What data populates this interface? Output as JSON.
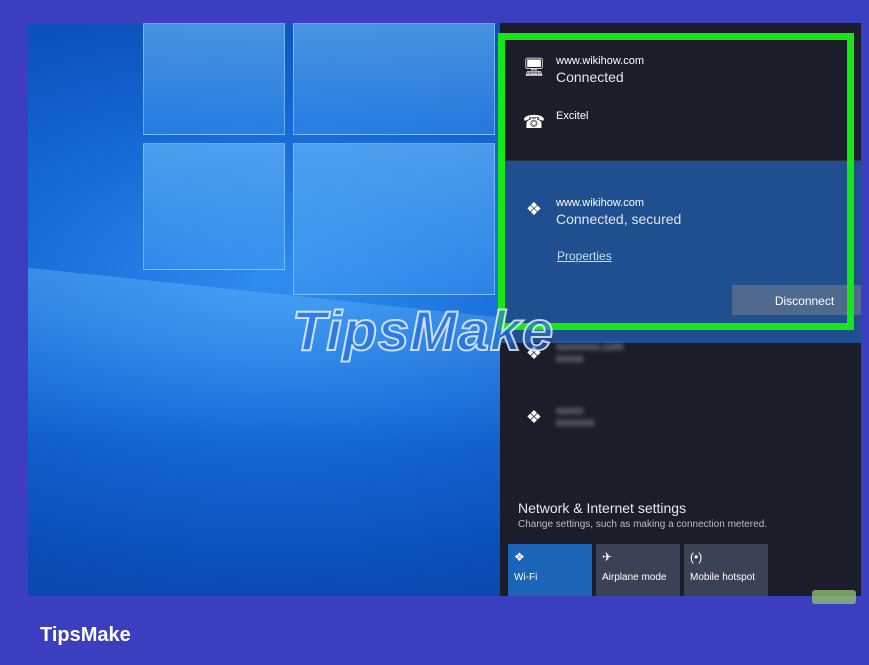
{
  "networks": [
    {
      "name": "www.wikihow.com",
      "status": "Connected",
      "icon": "ethernet-icon"
    },
    {
      "name": "Excitel",
      "status": "",
      "icon": "dialup-icon"
    },
    {
      "name": "www.wikihow.com",
      "status": "Connected, secured",
      "icon": "wifi-icon"
    }
  ],
  "selected_network": {
    "properties_link": "Properties",
    "disconnect_label": "Disconnect"
  },
  "blurred_networks": [
    {
      "name": "xxxxxxxx.com",
      "status": "xxxxx"
    },
    {
      "name": "xxxxx",
      "status": "xxxxxxx"
    }
  ],
  "settings": {
    "title": "Network & Internet settings",
    "subtitle": "Change settings, such as making a connection metered."
  },
  "quick_actions": [
    {
      "label": "Wi-Fi",
      "icon": "wifi-icon"
    },
    {
      "label": "Airplane mode",
      "icon": "airplane-icon"
    },
    {
      "label": "Mobile hotspot",
      "icon": "hotspot-icon"
    }
  ],
  "watermark": "TipsMake",
  "brand": "TipsMake",
  "colors": {
    "highlight": "#17e617",
    "frame": "#3b3fbf",
    "selected_bg": "#1f4f8f"
  }
}
